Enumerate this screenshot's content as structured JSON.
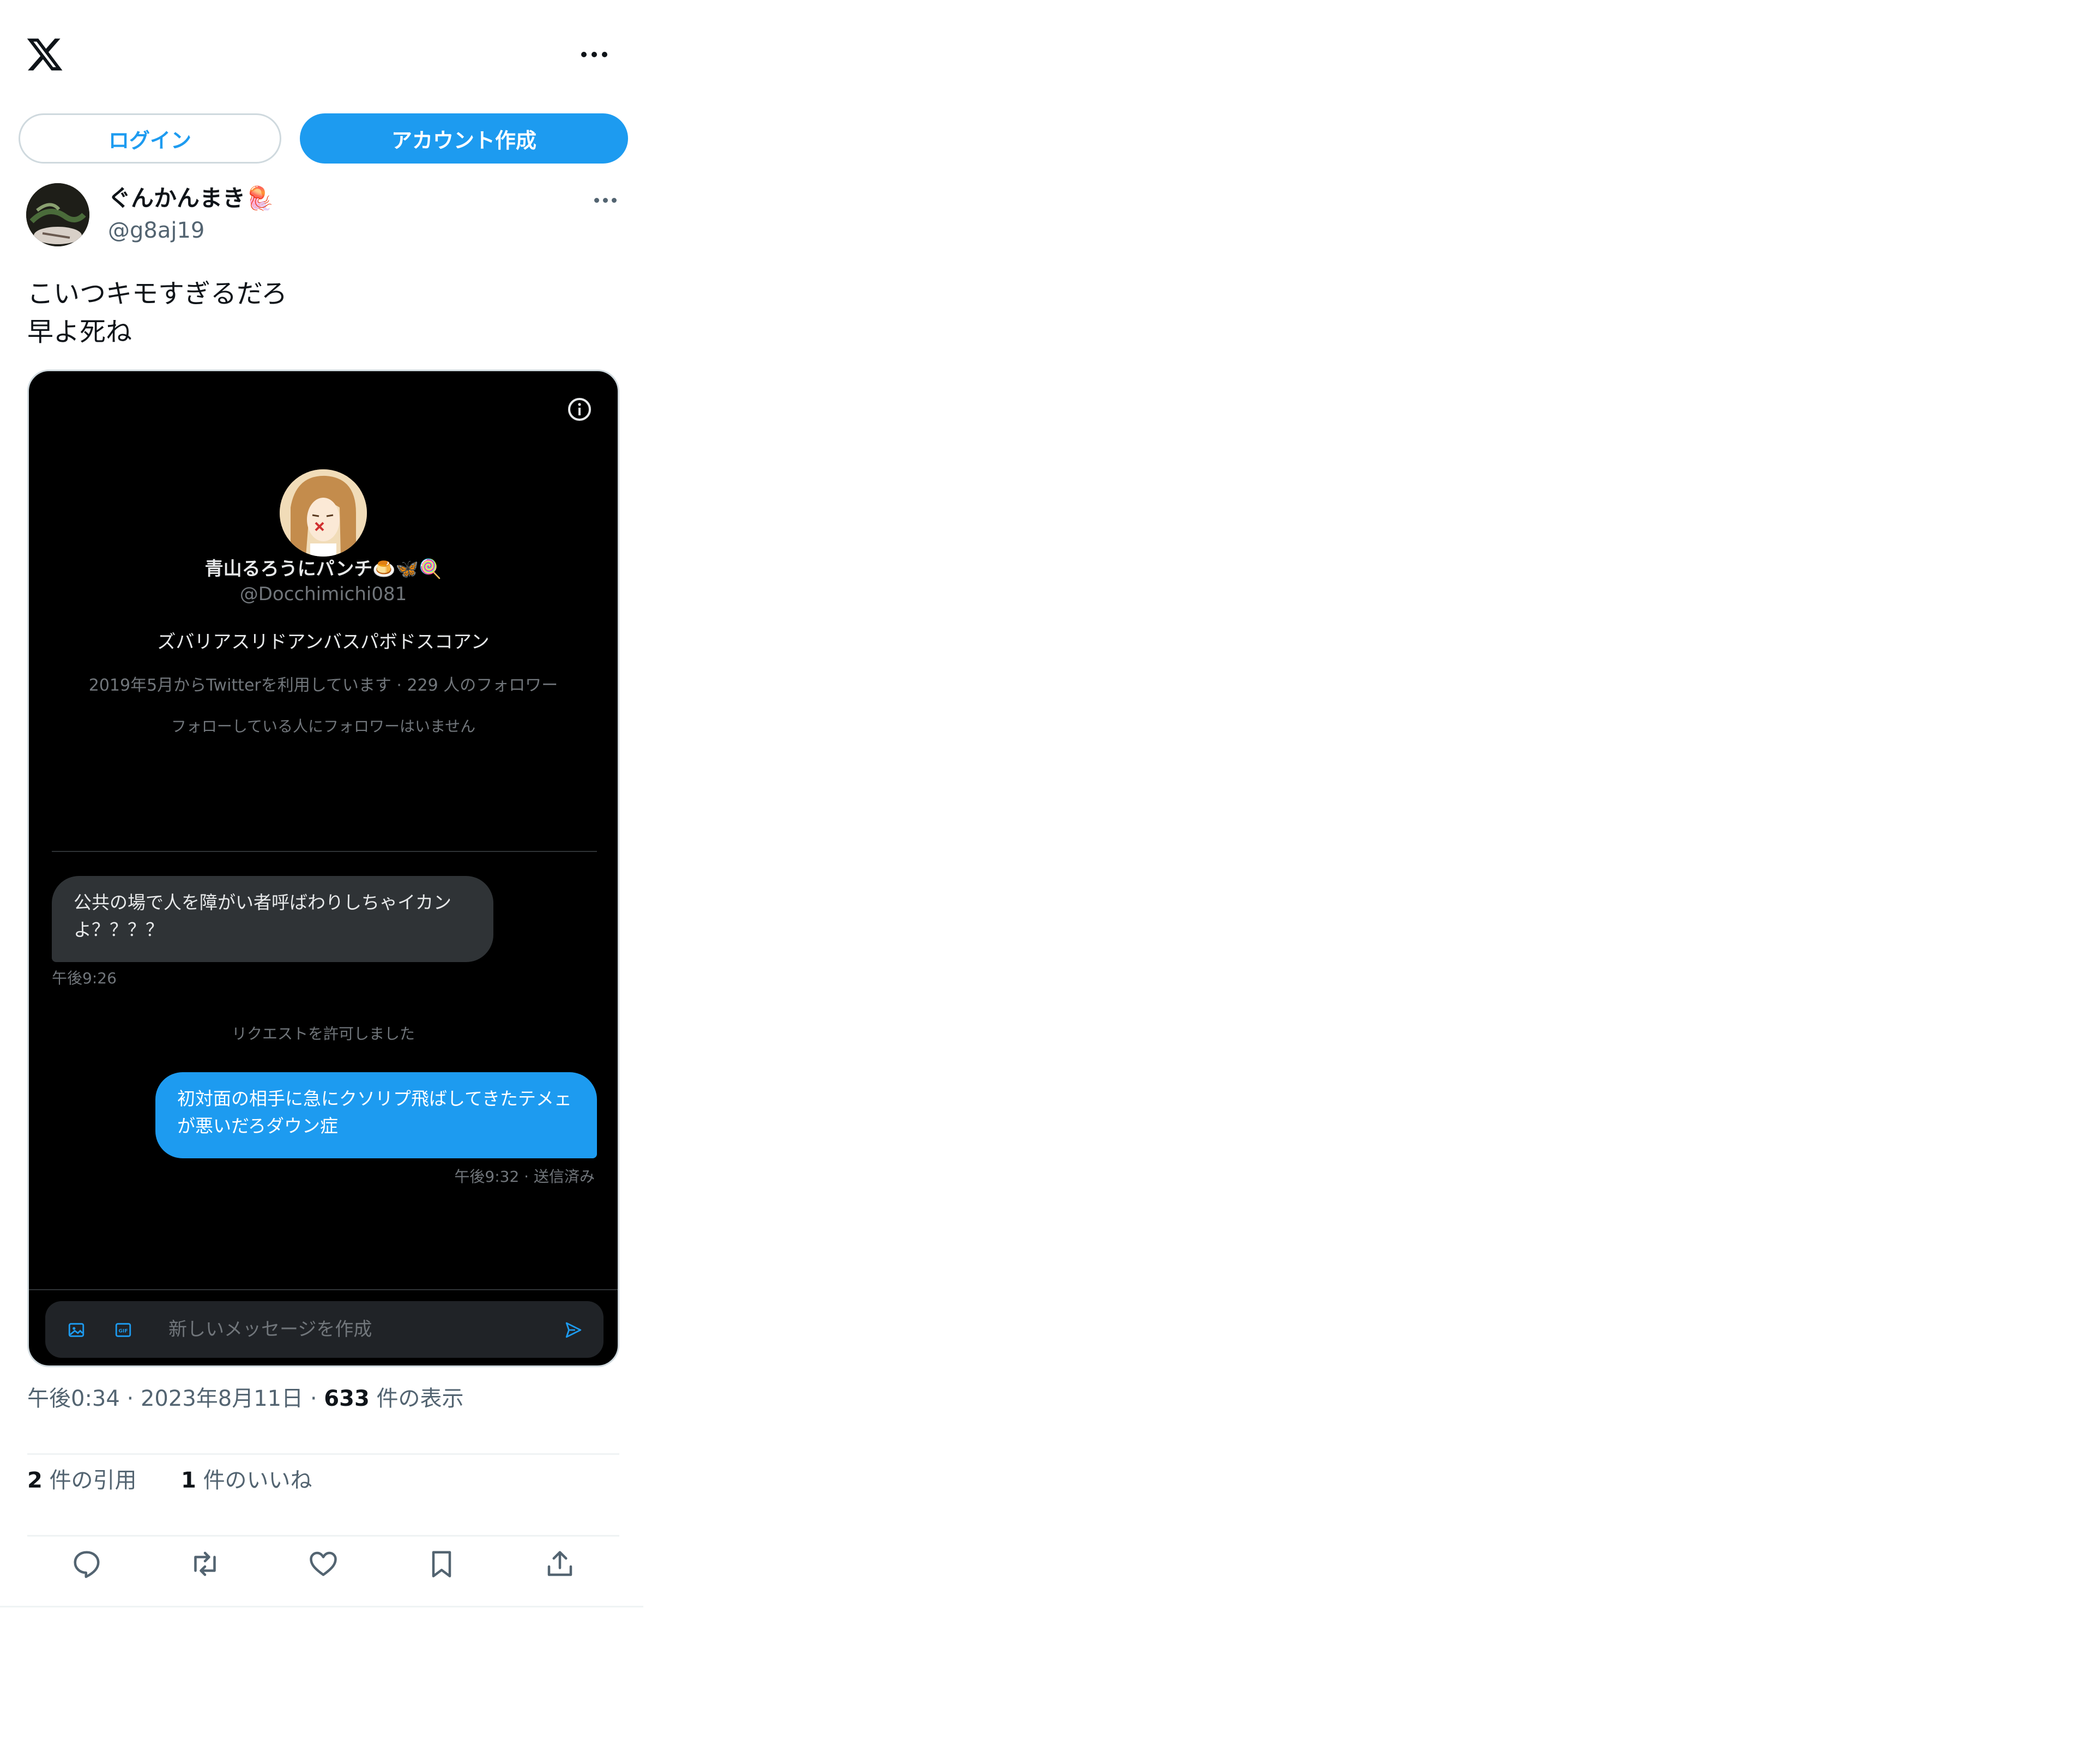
{
  "topbar": {
    "logo_icon": "x-logo-icon",
    "more_icon": "more-horizontal-icon"
  },
  "auth": {
    "login_label": "ログイン",
    "signup_label": "アカウント作成"
  },
  "author": {
    "display_name": "ぐんかんまき🪼",
    "handle": "@g8aj19"
  },
  "tweet": {
    "text_line1": "こいつキモすぎるだろ",
    "text_line2": "早よ死ね"
  },
  "media": {
    "profile": {
      "name": "青山るろうにパンチ🍮🦋🍭",
      "handle": "@Docchimichi081",
      "bio": "ズバリアスリドアンバスパボドスコアン",
      "meta": "2019年5月からTwitterを利用しています · 229 人のフォロワー",
      "mutuals": "フォローしている人にフォロワーはいません"
    },
    "messages": [
      {
        "direction": "in",
        "text": "公共の場で人を障がい者呼ばわりしちゃイカンよ？？？？",
        "time": "午後9:26"
      },
      {
        "direction": "out",
        "text": "初対面の相手に急にクソリプ飛ばしてきたテメェが悪いだろダウン症",
        "time": "午後9:32 · 送信済み"
      }
    ],
    "system_message": "リクエストを許可しました",
    "compose_placeholder": "新しいメッセージを作成",
    "icons": [
      "info-icon",
      "image-icon",
      "gif-icon",
      "send-icon"
    ]
  },
  "stats": {
    "time": "午後0:34",
    "date": "2023年8月11日",
    "views_count": "633",
    "views_label": "件の表示",
    "quotes_count": "2",
    "quotes_label": "件の引用",
    "likes_count": "1",
    "likes_label": "件のいいね"
  },
  "colors": {
    "accent": "#1d9bf0",
    "text": "#0f1419",
    "secondary": "#536471",
    "dm_background": "#000000",
    "dm_bubble_in": "#2f3336"
  }
}
